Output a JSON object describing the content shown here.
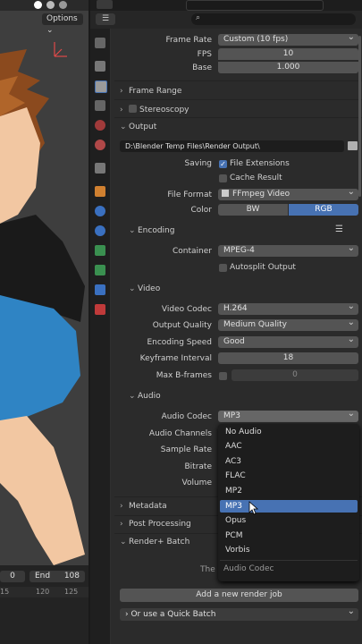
{
  "viewport": {
    "options_label": "Options"
  },
  "timeline": {
    "start_value": "0",
    "end_label": "End",
    "end_value": "108",
    "ticks": [
      "15",
      "120",
      "125"
    ]
  },
  "format": {
    "frame_rate_label": "Frame Rate",
    "frame_rate_value": "Custom (10 fps)",
    "fps_label": "FPS",
    "fps_value": "10",
    "base_label": "Base",
    "base_value": "1.000"
  },
  "sections": {
    "frame_range": "Frame Range",
    "stereoscopy": "Stereoscopy",
    "output": "Output",
    "encoding": "Encoding",
    "video": "Video",
    "audio": "Audio",
    "metadata": "Metadata",
    "post_processing": "Post Processing",
    "render_batch": "Render+ Batch"
  },
  "output": {
    "path": "D:\\Blender Temp Files\\Render Output\\",
    "saving_label": "Saving",
    "file_extensions_label": "File Extensions",
    "cache_result_label": "Cache Result",
    "file_format_label": "File Format",
    "file_format_value": "FFmpeg Video",
    "color_label": "Color",
    "color_bw": "BW",
    "color_rgb": "RGB"
  },
  "encoding": {
    "container_label": "Container",
    "container_value": "MPEG-4",
    "autosplit_label": "Autosplit Output"
  },
  "video": {
    "codec_label": "Video Codec",
    "codec_value": "H.264",
    "quality_label": "Output Quality",
    "quality_value": "Medium Quality",
    "speed_label": "Encoding Speed",
    "speed_value": "Good",
    "keyframe_label": "Keyframe Interval",
    "keyframe_value": "18",
    "bframes_label": "Max B-frames",
    "bframes_value": "0"
  },
  "audio": {
    "codec_label": "Audio Codec",
    "codec_value": "MP3",
    "channels_label": "Audio Channels",
    "sample_rate_label": "Sample Rate",
    "bitrate_label": "Bitrate",
    "volume_label": "Volume"
  },
  "menu": {
    "items": [
      "No Audio",
      "AAC",
      "AC3",
      "FLAC",
      "MP2",
      "MP3",
      "Opus",
      "PCM",
      "Vorbis"
    ],
    "footer": "Audio Codec"
  },
  "batch": {
    "partial_text": "The b",
    "add_job": "Add a new render job",
    "quick_batch": "Or use a Quick Batch"
  },
  "colors": {
    "accent": "#4772b3",
    "panel": "#2b2b2b",
    "field": "#545454"
  }
}
